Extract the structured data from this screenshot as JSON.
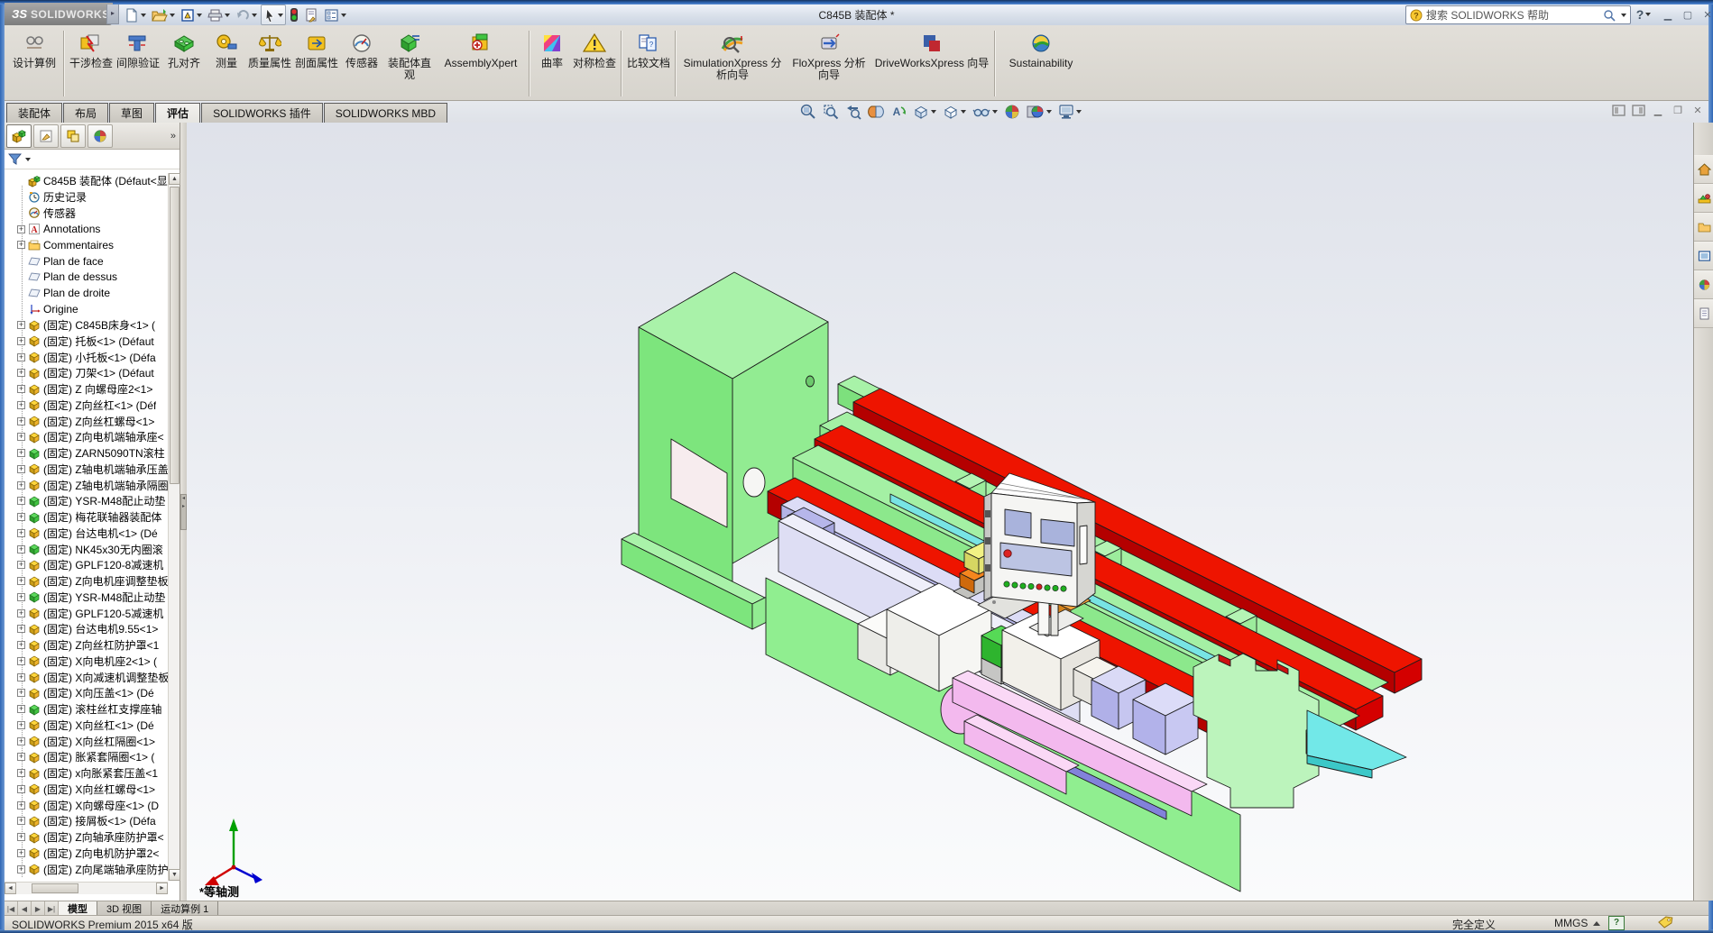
{
  "window": {
    "brand_ds": "ЗS",
    "brand": "SOLIDWORKS",
    "title": "C845B 装配体 *",
    "search_placeholder": "搜索 SOLIDWORKS 帮助"
  },
  "command_manager": {
    "design_study": "设计算例",
    "buttons": [
      {
        "label": "干涉检查"
      },
      {
        "label": "间隙验证"
      },
      {
        "label": "孔对齐"
      },
      {
        "label": "测量"
      },
      {
        "label": "质量属性"
      },
      {
        "label": "剖面属性"
      },
      {
        "label": "传感器"
      },
      {
        "label": "装配体直观"
      },
      {
        "label": "AssemblyXpert"
      },
      {
        "label": "曲率"
      },
      {
        "label": "对称检查"
      },
      {
        "label": "比较文档"
      },
      {
        "label": "SimulationXpress 分析向导"
      },
      {
        "label": "FloXpress 分析向导"
      },
      {
        "label": "DriveWorksXpress 向导"
      },
      {
        "label": "Sustainability"
      }
    ]
  },
  "tabs": {
    "items": [
      "装配体",
      "布局",
      "草图",
      "评估",
      "SOLIDWORKS 插件",
      "SOLIDWORKS MBD"
    ],
    "active": "评估"
  },
  "sidebar": {
    "tree": {
      "items": [
        {
          "e": "noexp",
          "icon": "asm",
          "label": "C845B 装配体  (Défaut<显"
        },
        {
          "e": "noexp",
          "icon": "hist",
          "label": "历史记录"
        },
        {
          "e": "noexp",
          "icon": "sensor",
          "label": "传感器"
        },
        {
          "e": "exp",
          "icon": "ann",
          "label": "Annotations"
        },
        {
          "e": "exp",
          "icon": "cmt",
          "label": "Commentaires"
        },
        {
          "e": "noexp",
          "icon": "plane",
          "label": "Plan de face"
        },
        {
          "e": "noexp",
          "icon": "plane",
          "label": "Plan de dessus"
        },
        {
          "e": "noexp",
          "icon": "plane",
          "label": "Plan de droite"
        },
        {
          "e": "noexp",
          "icon": "origin",
          "label": "Origine"
        },
        {
          "e": "exp",
          "icon": "part",
          "label": "(固定) C845B床身<1> ("
        },
        {
          "e": "exp",
          "icon": "part",
          "label": "(固定) 托板<1> (Défaut"
        },
        {
          "e": "exp",
          "icon": "part",
          "label": "(固定) 小托板<1> (Défa"
        },
        {
          "e": "exp",
          "icon": "part",
          "label": "(固定) 刀架<1> (Défaut"
        },
        {
          "e": "exp",
          "icon": "part",
          "label": "(固定) Z 向螺母座2<1>"
        },
        {
          "e": "exp",
          "icon": "part",
          "label": "(固定) Z向丝杠<1> (Déf"
        },
        {
          "e": "exp",
          "icon": "part",
          "label": "(固定) Z向丝杠螺母<1>"
        },
        {
          "e": "exp",
          "icon": "part",
          "label": "(固定) Z向电机端轴承座<"
        },
        {
          "e": "exp",
          "icon": "partg",
          "label": "(固定) ZARN5090TN滚柱"
        },
        {
          "e": "exp",
          "icon": "part",
          "label": "(固定) Z轴电机端轴承压盖"
        },
        {
          "e": "exp",
          "icon": "part",
          "label": "(固定) Z轴电机端轴承隔圈"
        },
        {
          "e": "exp",
          "icon": "partg",
          "label": "(固定) YSR-M48配止动垫"
        },
        {
          "e": "exp",
          "icon": "partg",
          "label": "(固定) 梅花联轴器装配体"
        },
        {
          "e": "exp",
          "icon": "part",
          "label": "(固定) 台达电机<1> (Dé"
        },
        {
          "e": "exp",
          "icon": "partg",
          "label": "(固定) NK45x30无内圈滚"
        },
        {
          "e": "exp",
          "icon": "part",
          "label": "(固定) GPLF120-8减速机"
        },
        {
          "e": "exp",
          "icon": "part",
          "label": "(固定) Z向电机座调整垫板"
        },
        {
          "e": "exp",
          "icon": "partg",
          "label": "(固定) YSR-M48配止动垫"
        },
        {
          "e": "exp",
          "icon": "part",
          "label": "(固定) GPLF120-5减速机"
        },
        {
          "e": "exp",
          "icon": "part",
          "label": "(固定) 台达电机9.55<1>"
        },
        {
          "e": "exp",
          "icon": "part",
          "label": "(固定) Z向丝杠防护罩<1"
        },
        {
          "e": "exp",
          "icon": "part",
          "label": "(固定) X向电机座2<1> ("
        },
        {
          "e": "exp",
          "icon": "part",
          "label": "(固定) X向减速机调整垫板"
        },
        {
          "e": "exp",
          "icon": "part",
          "label": "(固定) X向压盖<1> (Dé"
        },
        {
          "e": "exp",
          "icon": "partg",
          "label": "(固定) 滚柱丝杠支撑座轴"
        },
        {
          "e": "exp",
          "icon": "part",
          "label": "(固定) X向丝杠<1> (Dé"
        },
        {
          "e": "exp",
          "icon": "part",
          "label": "(固定) X向丝杠隔圈<1>"
        },
        {
          "e": "exp",
          "icon": "part",
          "label": "(固定) 胀紧套隔圈<1> ("
        },
        {
          "e": "exp",
          "icon": "part",
          "label": "(固定) x向胀紧套压盖<1"
        },
        {
          "e": "exp",
          "icon": "part",
          "label": "(固定) X向丝杠螺母<1>"
        },
        {
          "e": "exp",
          "icon": "part",
          "label": "(固定) X向螺母座<1> (D"
        },
        {
          "e": "exp",
          "icon": "part",
          "label": "(固定) 接屑板<1> (Défa"
        },
        {
          "e": "exp",
          "icon": "part",
          "label": "(固定) Z向轴承座防护罩<"
        },
        {
          "e": "exp",
          "icon": "part",
          "label": "(固定) Z向电机防护罩2<"
        },
        {
          "e": "exp",
          "icon": "part",
          "label": "(固定) Z向尾端轴承座防护"
        }
      ]
    }
  },
  "viewport": {
    "view_label": "*等轴测"
  },
  "bottom": {
    "tabs": [
      "模型",
      "3D 视图",
      "运动算例 1"
    ],
    "active": "模型"
  },
  "status_bar": {
    "product": "SOLIDWORKS Premium 2015 x64 版",
    "state": "完全定义",
    "units": "MMGS"
  },
  "model_colors": {
    "bed_green": "#8ce88c",
    "rail_red": "#ee1400",
    "screw_lavender": "#b4b4e6",
    "chain_pink": "#f3b9ee",
    "chip_tray_cyan": "#72e8e8",
    "panel_white": "#f5f5f3"
  }
}
